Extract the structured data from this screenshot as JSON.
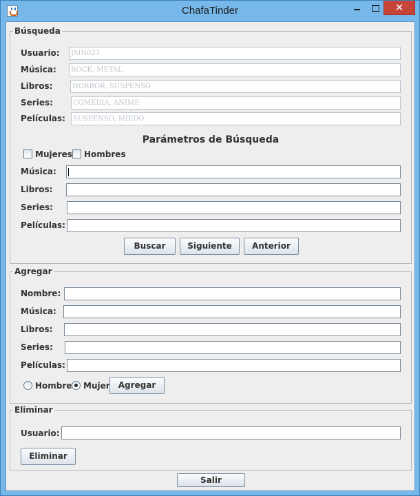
{
  "window": {
    "title": "ChafaTinder"
  },
  "busqueda": {
    "title": "Búsqueda",
    "profile": [
      {
        "label": "Usuario:",
        "value": "JMN023"
      },
      {
        "label": "Música:",
        "value": "ROCK, METAL"
      },
      {
        "label": "Libros:",
        "value": "HORROR, SUSPENSO"
      },
      {
        "label": "Series:",
        "value": "COMEDIA, ANIME"
      },
      {
        "label": "Películas:",
        "value": "SUSPENSO, MIEDO"
      }
    ],
    "params_heading": "Parámetros de Búsqueda",
    "checkbox_mujeres": "Mujeres",
    "checkbox_hombres": "Hombres",
    "filters": [
      {
        "label": "Música:",
        "value": ""
      },
      {
        "label": "Libros:",
        "value": ""
      },
      {
        "label": "Series:",
        "value": ""
      },
      {
        "label": "Películas:",
        "value": ""
      }
    ],
    "buttons": {
      "buscar": "Buscar",
      "siguiente": "Siguiente",
      "anterior": "Anterior"
    }
  },
  "agregar": {
    "title": "Agregar",
    "fields": [
      {
        "label": "Nombre:",
        "value": ""
      },
      {
        "label": "Música:",
        "value": ""
      },
      {
        "label": "Libros:",
        "value": ""
      },
      {
        "label": "Series:",
        "value": ""
      },
      {
        "label": "Películas:",
        "value": ""
      }
    ],
    "radio_hombre": "Hombre",
    "radio_mujer": "Mujer",
    "selected_gender": "Mujer",
    "button": "Agregar"
  },
  "eliminar": {
    "title": "Eliminar",
    "usuario_label": "Usuario:",
    "usuario_value": "",
    "button": "Eliminar"
  },
  "salir_button": "Salir"
}
